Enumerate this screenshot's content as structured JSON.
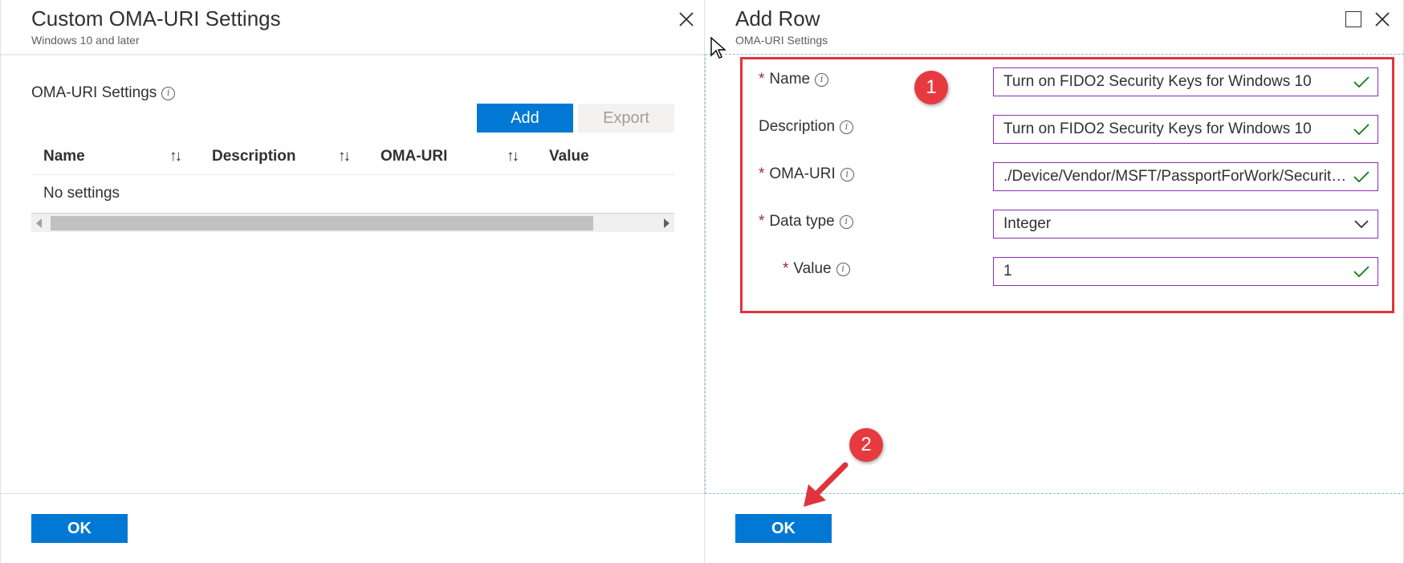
{
  "left_blade": {
    "title": "Custom OMA-URI Settings",
    "subtitle": "Windows 10 and later",
    "section_label": "OMA-URI Settings",
    "add_label": "Add",
    "export_label": "Export",
    "columns": [
      "Name",
      "Description",
      "OMA-URI",
      "Value"
    ],
    "sort_glyph": "↑↓",
    "empty_text": "No settings",
    "ok_label": "OK"
  },
  "right_blade": {
    "title": "Add Row",
    "subtitle": "OMA-URI Settings",
    "required_mark": "*",
    "fields": [
      {
        "label": "Name",
        "required": true,
        "value": "Turn on FIDO2 Security Keys for Windows 10"
      },
      {
        "label": "Description",
        "required": false,
        "value": "Turn on FIDO2 Security Keys for Windows 10"
      },
      {
        "label": "OMA-URI",
        "required": true,
        "value": "./Device/Vendor/MSFT/PassportForWork/SecurityKey/UseSecurityKeyForSignin"
      },
      {
        "label": "Data type",
        "required": true,
        "value": "Integer"
      },
      {
        "label": "Value",
        "required": true,
        "value": "1"
      }
    ],
    "ok_label": "OK"
  },
  "annotations": {
    "badge_1": "1",
    "badge_2": "2"
  },
  "colors": {
    "primary": "#0078d4",
    "field_border": "#8a2fb4",
    "valid_check": "#107c10",
    "annotation_red": "#e0333c"
  },
  "icons": [
    "info-icon",
    "close-icon",
    "maximize-icon",
    "check-icon",
    "chevron-down-icon",
    "sort-icon",
    "cursor-icon",
    "annotation-arrow-icon"
  ]
}
